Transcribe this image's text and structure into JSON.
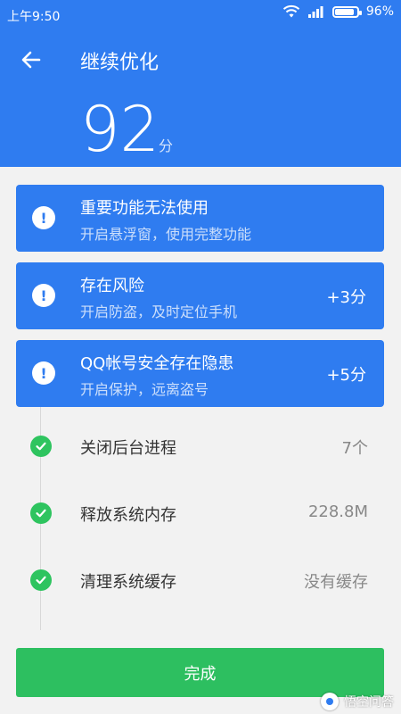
{
  "status": {
    "time": "上午9:50",
    "battery": "96%",
    "battery_level": 0.96
  },
  "header": {
    "title": "继续优化",
    "score": "92",
    "score_unit": "分"
  },
  "cards": [
    {
      "title": "重要功能无法使用",
      "subtitle": "开启悬浮窗，使用完整功能",
      "bonus": ""
    },
    {
      "title": "存在风险",
      "subtitle": "开启防盗，及时定位手机",
      "bonus": "+3分"
    },
    {
      "title": "QQ帐号安全存在隐患",
      "subtitle": "开启保护，远离盗号",
      "bonus": "+5分"
    }
  ],
  "done_items": [
    {
      "label": "关闭后台进程",
      "value": "7个"
    },
    {
      "label": "释放系统内存",
      "value": "228.8M"
    },
    {
      "label": "清理系统缓存",
      "value": "没有缓存"
    }
  ],
  "finish_label": "完成",
  "watermark": "悟空问答",
  "colors": {
    "primary": "#2f7cf0",
    "success": "#2dbf60",
    "background": "#f2f2f2"
  }
}
